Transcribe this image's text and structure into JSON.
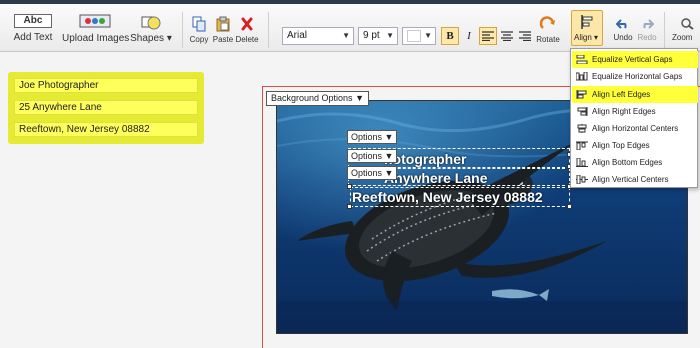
{
  "toolbar": {
    "add_text": "Add Text",
    "add_text_icon_text": "Abc",
    "upload_images": "Upload Images",
    "shapes": "Shapes",
    "copy": "Copy",
    "paste": "Paste",
    "delete": "Delete",
    "font_family": "Arial",
    "font_size": "9 pt",
    "bold": "B",
    "italic": "I",
    "rotate": "Rotate",
    "align": "Align",
    "undo": "Undo",
    "redo": "Redo",
    "zoom": "Zoom"
  },
  "left_panel": {
    "fields": [
      "Joe Photographer",
      "25 Anywhere Lane",
      "Reeftown, New Jersey 08882"
    ]
  },
  "canvas": {
    "background_options": "Background Options",
    "options_label": "Options",
    "lines": [
      "Joe Photographer",
      "25 Anywhere Lane",
      "Reeftown, New Jersey 08882"
    ],
    "visible_lines": [
      "hotographer",
      "Anywhere Lane",
      "Reeftown, New Jersey 08882"
    ]
  },
  "align_menu": {
    "items": [
      {
        "label": "Equalize Vertical Gaps",
        "highlighted": true
      },
      {
        "label": "Equalize Horizontal Gaps",
        "highlighted": false
      },
      {
        "label": "Align Left Edges",
        "highlighted": true
      },
      {
        "label": "Align Right Edges",
        "highlighted": false
      },
      {
        "label": "Align Horizontal Centers",
        "highlighted": false
      },
      {
        "label": "Align Top Edges",
        "highlighted": false
      },
      {
        "label": "Align Bottom Edges",
        "highlighted": false
      },
      {
        "label": "Align Vertical Centers",
        "highlighted": false
      }
    ]
  },
  "colors": {
    "highlight": "#ffff3a",
    "left_panel": "#e5ea33",
    "canvas_border": "#e34a4a",
    "active_button": "#ffe9a8"
  }
}
